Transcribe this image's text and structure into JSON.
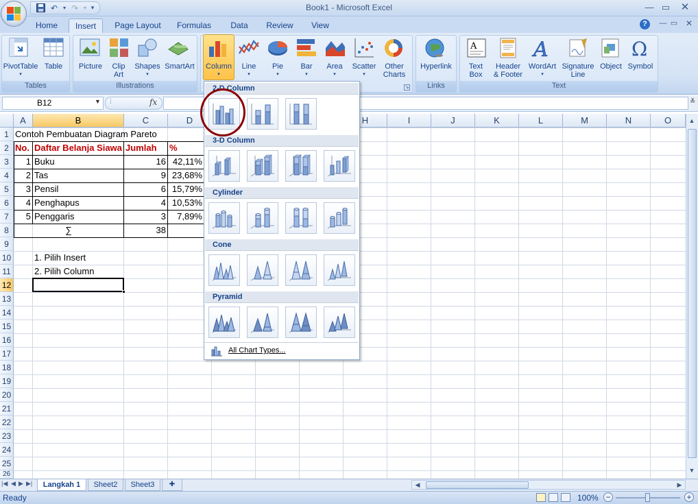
{
  "window": {
    "title": "Book1 - Microsoft Excel"
  },
  "ribbon_tabs": [
    "Home",
    "Insert",
    "Page Layout",
    "Formulas",
    "Data",
    "Review",
    "View"
  ],
  "ribbon": {
    "groups": {
      "tables": "Tables",
      "illustrations": "Illustrations",
      "links": "Links",
      "text": "Text"
    },
    "buttons": {
      "pivottable": "PivotTable",
      "table": "Table",
      "picture": "Picture",
      "clip_art_1": "Clip",
      "clip_art_2": "Art",
      "shapes": "Shapes",
      "smartart": "SmartArt",
      "column": "Column",
      "line": "Line",
      "pie": "Pie",
      "bar": "Bar",
      "area": "Area",
      "scatter": "Scatter",
      "other_1": "Other",
      "other_2": "Charts",
      "hyperlink": "Hyperlink",
      "textbox_1": "Text",
      "textbox_2": "Box",
      "header_1": "Header",
      "header_2": "& Footer",
      "wordart": "WordArt",
      "signature_1": "Signature",
      "signature_2": "Line",
      "object": "Object",
      "symbol": "Symbol"
    }
  },
  "formula_bar": {
    "name_box": "B12",
    "fx": "fx",
    "content": ""
  },
  "columns": [
    "A",
    "B",
    "C",
    "D",
    "E",
    "F",
    "G",
    "H",
    "I",
    "J",
    "K",
    "L",
    "M",
    "N",
    "O"
  ],
  "rows": [
    "1",
    "2",
    "3",
    "4",
    "5",
    "6",
    "7",
    "8",
    "9",
    "10",
    "11",
    "12",
    "13",
    "14",
    "15",
    "16",
    "17",
    "18",
    "19",
    "20",
    "21",
    "22",
    "23",
    "24",
    "25",
    "26"
  ],
  "sheet": {
    "a1": "Contoh Pembuatan Diagram Pareto",
    "header": {
      "no": "No.",
      "item": "Daftar Belanja Siawa",
      "qty": "Jumlah",
      "pct": "%"
    },
    "rows": [
      {
        "no": "1",
        "item": "Buku",
        "qty": "16",
        "pct": "42,11%"
      },
      {
        "no": "2",
        "item": "Tas",
        "qty": "9",
        "pct": "23,68%"
      },
      {
        "no": "3",
        "item": "Pensil",
        "qty": "6",
        "pct": "15,79%"
      },
      {
        "no": "4",
        "item": "Penghapus",
        "qty": "4",
        "pct": "10,53%"
      },
      {
        "no": "5",
        "item": "Penggaris",
        "qty": "3",
        "pct": "7,89%"
      }
    ],
    "total_symbol": "∑",
    "total": "38",
    "note1": "1. Pilih Insert",
    "note2": "2. Pilih Column"
  },
  "dropdown": {
    "sections": [
      "2-D Column",
      "3-D Column",
      "Cylinder",
      "Cone",
      "Pyramid"
    ],
    "footer": "All Chart Types..."
  },
  "sheet_tabs": [
    "Langkah 1",
    "Sheet2",
    "Sheet3"
  ],
  "status": {
    "ready": "Ready",
    "zoom": "100%"
  },
  "colors": {
    "accent_red": "#c00000",
    "highlight_circle": "#8b0000",
    "ribbon_blue": "#15428b"
  }
}
